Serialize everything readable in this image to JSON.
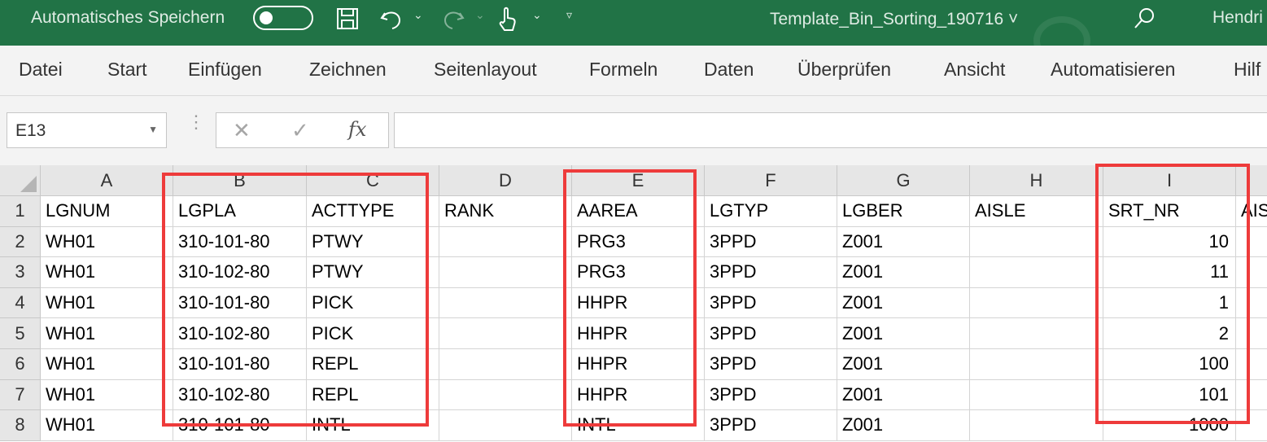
{
  "titlebar": {
    "autosave_label": "Automatisches Speichern",
    "document_title": "Template_Bin_Sorting_190716 ˅",
    "user": "Hendri",
    "background": "#217346"
  },
  "ribbon": {
    "tabs": [
      "Datei",
      "Start",
      "Einfügen",
      "Zeichnen",
      "Seitenlayout",
      "Formeln",
      "Daten",
      "Überprüfen",
      "Ansicht",
      "Automatisieren",
      "Hilf"
    ]
  },
  "formula_bar": {
    "name_box": "E13",
    "formula": ""
  },
  "sheet": {
    "columns": [
      "A",
      "B",
      "C",
      "D",
      "E",
      "F",
      "G",
      "H",
      "I"
    ],
    "extra_column_header_partial": "AIS",
    "rows": [
      {
        "num": "1",
        "cells": [
          "LGNUM",
          "LGPLA",
          "ACTTYPE",
          "RANK",
          "AAREA",
          "LGTYP",
          "LGBER",
          "AISLE",
          "SRT_NR"
        ]
      },
      {
        "num": "2",
        "cells": [
          "WH01",
          "310-101-80",
          "PTWY",
          "",
          "PRG3",
          "3PPD",
          "Z001",
          "",
          "10"
        ]
      },
      {
        "num": "3",
        "cells": [
          "WH01",
          "310-102-80",
          "PTWY",
          "",
          "PRG3",
          "3PPD",
          "Z001",
          "",
          "11"
        ]
      },
      {
        "num": "4",
        "cells": [
          "WH01",
          "310-101-80",
          "PICK",
          "",
          "HHPR",
          "3PPD",
          "Z001",
          "",
          "1"
        ]
      },
      {
        "num": "5",
        "cells": [
          "WH01",
          "310-102-80",
          "PICK",
          "",
          "HHPR",
          "3PPD",
          "Z001",
          "",
          "2"
        ]
      },
      {
        "num": "6",
        "cells": [
          "WH01",
          "310-101-80",
          "REPL",
          "",
          "HHPR",
          "3PPD",
          "Z001",
          "",
          "100"
        ]
      },
      {
        "num": "7",
        "cells": [
          "WH01",
          "310-102-80",
          "REPL",
          "",
          "HHPR",
          "3PPD",
          "Z001",
          "",
          "101"
        ]
      },
      {
        "num": "8",
        "cells": [
          "WH01",
          "310-101-80",
          "INTL",
          "",
          "INTL",
          "3PPD",
          "Z001",
          "",
          "1000"
        ]
      }
    ],
    "highlight_color": "#ee3b3b"
  }
}
